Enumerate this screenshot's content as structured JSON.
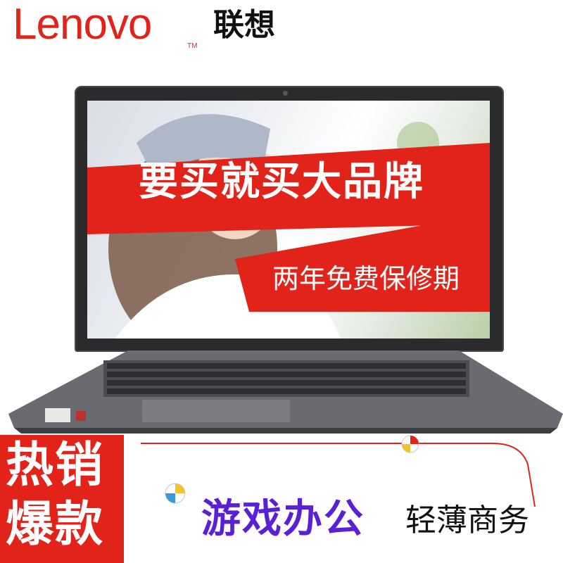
{
  "header": {
    "brand_logo": "Lenovo",
    "brand_tm": "TM",
    "brand_cn": "联想",
    "brand_color": "#e2231a"
  },
  "screen": {
    "slogan": "要买就买大品牌",
    "warranty": "两年免费保修期",
    "banner_color": "#e2231a"
  },
  "bottom": {
    "hot_line1": "热销",
    "hot_line2": "爆款",
    "game_office": "游戏办公",
    "business": "轻薄商务",
    "accent_purple": "#5a1fd6"
  },
  "icons": [
    "beach-ball-icon"
  ]
}
